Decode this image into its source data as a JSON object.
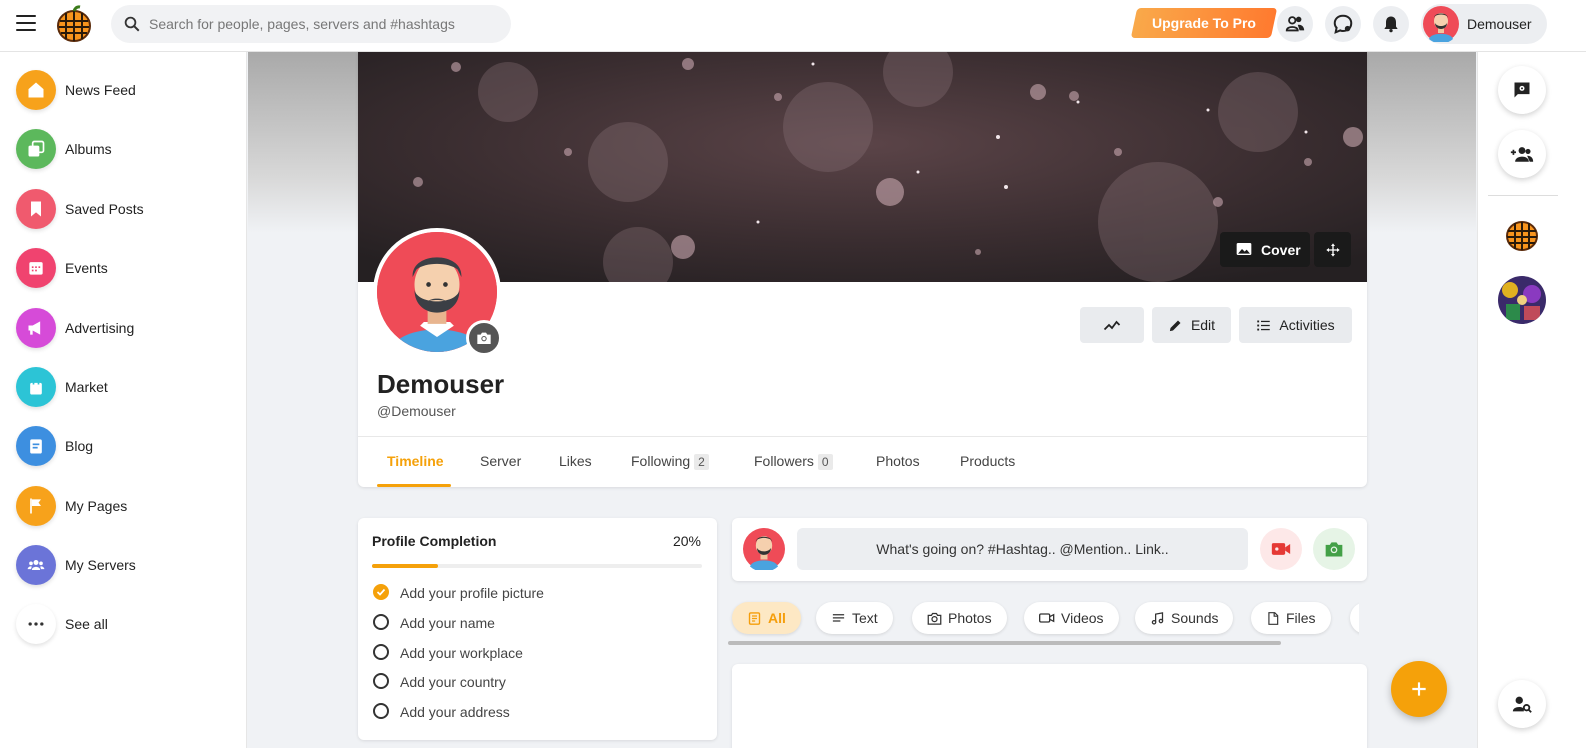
{
  "topbar": {
    "search_placeholder": "Search for people, pages, servers and #hashtags",
    "upgrade_label": "Upgrade To Pro",
    "username": "Demouser"
  },
  "sidebar": {
    "items": [
      {
        "label": "News Feed",
        "icon": "home-icon",
        "color": "#f7a21b"
      },
      {
        "label": "Albums",
        "icon": "albums-icon",
        "color": "#5cb85c"
      },
      {
        "label": "Saved Posts",
        "icon": "bookmark-icon",
        "color": "#f05a6e"
      },
      {
        "label": "Events",
        "icon": "calendar-icon",
        "color": "#f0436f"
      },
      {
        "label": "Advertising",
        "icon": "megaphone-icon",
        "color": "#d64bd8"
      },
      {
        "label": "Market",
        "icon": "shopping-bag-icon",
        "color": "#2cc4d6"
      },
      {
        "label": "Blog",
        "icon": "blog-icon",
        "color": "#3d8fe0"
      },
      {
        "label": "My Pages",
        "icon": "flag-icon",
        "color": "#f7a21b"
      },
      {
        "label": "My Servers",
        "icon": "group-icon",
        "color": "#6b74d8"
      },
      {
        "label": "See all",
        "icon": "more-icon",
        "color": "#ffffff"
      }
    ]
  },
  "profile": {
    "cover_label": "Cover",
    "edit_label": "Edit",
    "activities_label": "Activities",
    "name": "Demouser",
    "handle": "@Demouser"
  },
  "tabs": {
    "timeline": "Timeline",
    "server": "Server",
    "likes": "Likes",
    "following": "Following",
    "following_count": "2",
    "followers": "Followers",
    "followers_count": "0",
    "photos": "Photos",
    "products": "Products"
  },
  "completion": {
    "title": "Profile Completion",
    "percent_label": "20%",
    "progress": 0.2,
    "items": [
      {
        "label": "Add your profile picture",
        "done": true
      },
      {
        "label": "Add your name",
        "done": false
      },
      {
        "label": "Add your workplace",
        "done": false
      },
      {
        "label": "Add your country",
        "done": false
      },
      {
        "label": "Add your address",
        "done": false
      }
    ]
  },
  "composer": {
    "placeholder": "What's going on? #Hashtag.. @Mention.. Link.."
  },
  "filters": {
    "all": "All",
    "text": "Text",
    "photos": "Photos",
    "videos": "Videos",
    "sounds": "Sounds",
    "files": "Files"
  },
  "colors": {
    "accent": "#f5a10a",
    "upgrade_start": "#f9a94a",
    "upgrade_end": "#ff7a2f"
  }
}
